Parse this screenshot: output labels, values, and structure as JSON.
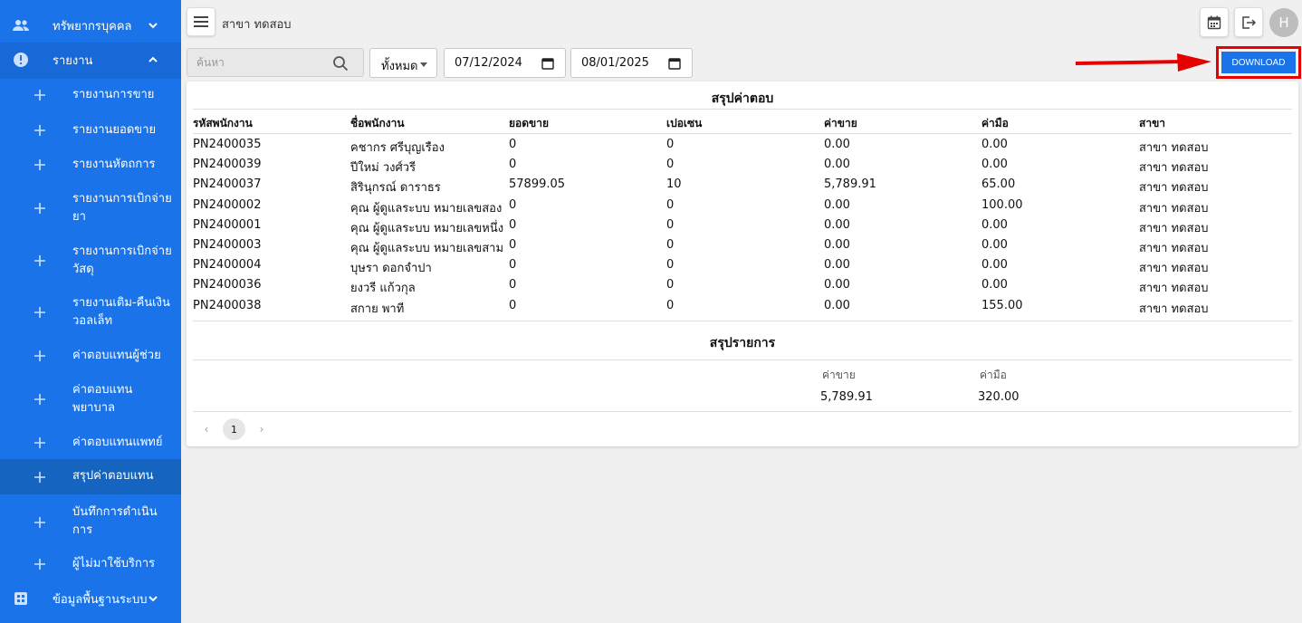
{
  "sidebar": {
    "top_item": {
      "label": "ทรัพยากรบุคคล",
      "icon": "people-icon"
    },
    "report_group": {
      "label": "รายงาน",
      "icon": "alert-circle-icon"
    },
    "sub_items": [
      {
        "label": "รายงานการขาย"
      },
      {
        "label": "รายงานยอดขาย"
      },
      {
        "label": "รายงานหัตถการ"
      },
      {
        "label": "รายงานการเบิกจ่ายยา"
      },
      {
        "label": "รายงานการเบิกจ่ายวัสดุ"
      },
      {
        "label": "รายงานเติม-คืนเงินวอลเล็ท"
      },
      {
        "label": "ค่าตอบแทนผู้ช่วย"
      },
      {
        "label": "ค่าตอบแทนพยาบาล"
      },
      {
        "label": "ค่าตอบแทนแพทย์"
      },
      {
        "label": "สรุปค่าตอบแทน"
      },
      {
        "label": "บันทึกการดำเนินการ"
      },
      {
        "label": "ผู้ไม่มาใช้บริการ"
      }
    ],
    "bottom_item": {
      "label": "ข้อมูลพื้นฐานระบบ",
      "icon": "grid-icon"
    }
  },
  "header": {
    "branch": "สาขา ทดสอบ",
    "avatar_letter": "H"
  },
  "filters": {
    "search_placeholder": "ค้นหา",
    "select_value": "ทั้งหมด",
    "date_from": "07/12/2024",
    "date_to": "08/01/2025",
    "download_label": "DOWNLOAD"
  },
  "summary_table": {
    "title": "สรุปค่าตอบ",
    "columns": [
      "รหัสพนักงาน",
      "ชื่อพนักงาน",
      "ยอดขาย",
      "เปอเซน",
      "ค่าขาย",
      "ค่ามือ",
      "สาขา"
    ],
    "rows": [
      [
        "PN2400035",
        "คชากร ศรีบุญเรือง",
        "0",
        "0",
        "0.00",
        "0.00",
        "สาขา ทดสอบ"
      ],
      [
        "PN2400039",
        "ปีใหม่ วงศ์วรี",
        "0",
        "0",
        "0.00",
        "0.00",
        "สาขา ทดสอบ"
      ],
      [
        "PN2400037",
        "สิรินุกรณ์ ดาราธร",
        "57899.05",
        "10",
        "5,789.91",
        "65.00",
        "สาขา ทดสอบ"
      ],
      [
        "PN2400002",
        "คุณ ผู้ดูแลระบบ หมายเลขสอง",
        "0",
        "0",
        "0.00",
        "100.00",
        "สาขา ทดสอบ"
      ],
      [
        "PN2400001",
        "คุณ ผู้ดูแลระบบ หมายเลขหนึ่ง",
        "0",
        "0",
        "0.00",
        "0.00",
        "สาขา ทดสอบ"
      ],
      [
        "PN2400003",
        "คุณ ผู้ดูแลระบบ หมายเลขสาม",
        "0",
        "0",
        "0.00",
        "0.00",
        "สาขา ทดสอบ"
      ],
      [
        "PN2400004",
        "บุษรา ดอกจำปา",
        "0",
        "0",
        "0.00",
        "0.00",
        "สาขา ทดสอบ"
      ],
      [
        "PN2400036",
        "ยงวรี แก้วกุล",
        "0",
        "0",
        "0.00",
        "0.00",
        "สาขา ทดสอบ"
      ],
      [
        "PN2400038",
        "สกาย พาที",
        "0",
        "0",
        "0.00",
        "155.00",
        "สาขา ทดสอบ"
      ]
    ]
  },
  "totals": {
    "title": "สรุปรายการ",
    "sale_label": "ค่าขาย",
    "hand_label": "ค่ามือ",
    "sale_value": "5,789.91",
    "hand_value": "320.00"
  },
  "pagination": {
    "prev": "‹",
    "page": "1",
    "next": "›"
  }
}
